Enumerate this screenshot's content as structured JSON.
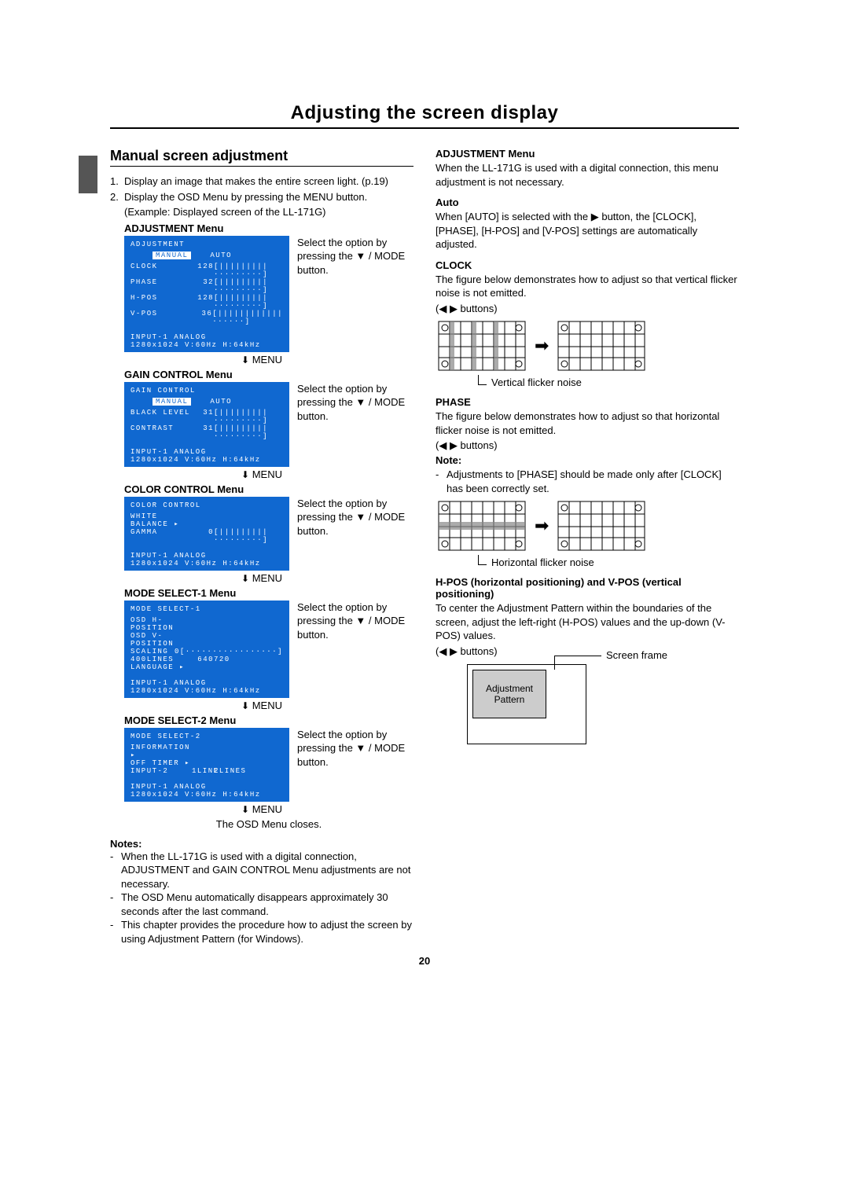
{
  "page_title": "Adjusting the screen display",
  "page_number": "20",
  "left": {
    "heading": "Manual screen adjustment",
    "step1_num": "1.",
    "step1": "Display an image that makes the entire screen light. (p.19)",
    "step2_num": "2.",
    "step2": "Display the OSD Menu by pressing the MENU button.",
    "example": "(Example: Displayed screen of the LL-171G)",
    "menu_arrow_label": "MENU",
    "close_text": "The OSD Menu closes.",
    "side_text": "Select the option by pressing the ▼ / MODE button.",
    "menus": [
      {
        "label": "ADJUSTMENT Menu",
        "osd_title": "ADJUSTMENT",
        "tab_sel": "MANUAL",
        "tab_other": "AUTO",
        "rows": [
          {
            "lab": "CLOCK",
            "val": "128",
            "bar": "[|||||||||·········]"
          },
          {
            "lab": "PHASE",
            "val": "32",
            "bar": "[|||||||||·········]"
          },
          {
            "lab": "H-POS",
            "val": "128",
            "bar": "[|||||||||·········]"
          },
          {
            "lab": "V-POS",
            "val": "36",
            "bar": "[||||||||||||······]"
          }
        ],
        "foot1": "INPUT-1    ANALOG",
        "foot2": "1280x1024  V:60Hz  H:64kHz"
      },
      {
        "label": "GAIN CONTROL Menu",
        "osd_title": "GAIN CONTROL",
        "tab_sel": "MANUAL",
        "tab_other": "AUTO",
        "rows": [
          {
            "lab": "BLACK LEVEL",
            "val": "31",
            "bar": "[|||||||||·········]"
          },
          {
            "lab": "CONTRAST",
            "val": "31",
            "bar": "[|||||||||·········]"
          }
        ],
        "foot1": "INPUT-1    ANALOG",
        "foot2": "1280x1024  V:60Hz  H:64kHz"
      },
      {
        "label": "COLOR CONTROL Menu",
        "osd_title": "COLOR CONTROL",
        "tab_sel": "",
        "tab_other": "",
        "rows": [
          {
            "lab": "WHITE BALANCE ▸",
            "val": "",
            "bar": ""
          },
          {
            "lab": "GAMMA",
            "val": "0",
            "bar": "[|||||||||·········]"
          }
        ],
        "foot1": "INPUT-1    ANALOG",
        "foot2": "1280x1024  V:60Hz  H:64kHz"
      },
      {
        "label": "MODE SELECT-1 Menu",
        "osd_title": "MODE SELECT-1",
        "tab_sel": "",
        "tab_other": "",
        "rows": [
          {
            "lab": "OSD H-POSITION",
            "val": "",
            "bar": ""
          },
          {
            "lab": "OSD V-POSITION",
            "val": "",
            "bar": ""
          },
          {
            "lab": "SCALING",
            "val": "0",
            "bar": "[·················]"
          },
          {
            "lab": "400LINES",
            "val": "640",
            "bar": "720"
          },
          {
            "lab": "LANGUAGE ▸",
            "val": "",
            "bar": ""
          }
        ],
        "foot1": "INPUT-1    ANALOG",
        "foot2": "1280x1024  V:60Hz  H:64kHz"
      },
      {
        "label": "MODE SELECT-2 Menu",
        "osd_title": "MODE SELECT-2",
        "tab_sel": "",
        "tab_other": "",
        "rows": [
          {
            "lab": "INFORMATION ▸",
            "val": "",
            "bar": ""
          },
          {
            "lab": "OFF TIMER ▸",
            "val": "",
            "bar": ""
          },
          {
            "lab": "INPUT-2",
            "val": "1LINE",
            "bar": "2LINES"
          }
        ],
        "foot1": "INPUT-1    ANALOG",
        "foot2": "1280x1024  V:60Hz  H:64kHz"
      }
    ],
    "notes_h": "Notes:",
    "note1": "When the LL-171G is used with a digital connection, ADJUSTMENT and GAIN CONTROL Menu adjustments are not necessary.",
    "note2": "The OSD Menu automatically disappears approximately 30 seconds after the last command.",
    "note3": "This chapter provides the procedure how to adjust the screen by using Adjustment Pattern (for Windows)."
  },
  "right": {
    "h1": "ADJUSTMENT Menu",
    "p1": "When the LL-171G is used with a digital connection, this menu adjustment is not necessary.",
    "h_auto": "Auto",
    "p_auto": "When [AUTO] is selected with the ▶ button, the [CLOCK], [PHASE], [H-POS] and [V-POS] settings are automatically adjusted.",
    "h_clock": "CLOCK",
    "p_clock": "The figure below demonstrates how to adjust so that vertical flicker noise is not emitted.",
    "buttons_label": "(◀ ▶ buttons)",
    "cap_clock": "Vertical flicker noise",
    "h_phase": "PHASE",
    "p_phase": "The figure below demonstrates how to adjust so that horizontal flicker noise is not emitted.",
    "note_h": "Note:",
    "phase_note": "Adjustments to [PHASE] should be made only after [CLOCK] has been correctly set.",
    "cap_phase": "Horizontal flicker noise",
    "h_pos": "H-POS (horizontal positioning) and V-POS (vertical positioning)",
    "p_pos": "To center the Adjustment Pattern within the boundaries of the screen, adjust the left-right (H-POS) values and the up-down (V-POS) values.",
    "frame_label": "Screen frame",
    "pattern_label": "Adjustment Pattern"
  }
}
